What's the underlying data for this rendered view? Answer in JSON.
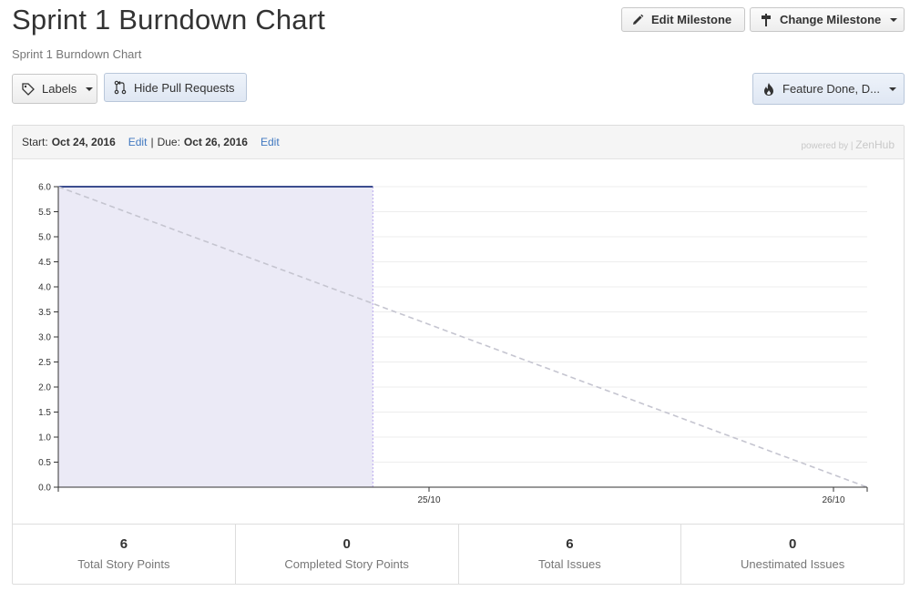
{
  "header": {
    "title": "Sprint 1 Burndown Chart",
    "subtitle": "Sprint 1 Burndown Chart"
  },
  "toolbar": {
    "edit_milestone_label": "Edit Milestone",
    "change_milestone_label": "Change Milestone",
    "labels_label": "Labels",
    "hide_pull_requests_label": "Hide Pull Requests",
    "filter_label": "Feature Done, D..."
  },
  "panel": {
    "start_prefix": "Start:",
    "start_date": "Oct 24, 2016",
    "edit_start_label": "Edit",
    "separator": "|",
    "due_prefix": "Due:",
    "due_date": "Oct 26, 2016",
    "edit_due_label": "Edit",
    "powered_by": "powered by |",
    "powered_brand": "ZenHub"
  },
  "chart_data": {
    "type": "area",
    "x_domain": [
      "2016-10-24T00:00",
      "2016-10-26T00:00"
    ],
    "ylim": [
      0,
      6
    ],
    "yticks": [
      "0.0",
      "0.5",
      "1.0",
      "1.5",
      "2.0",
      "2.5",
      "3.0",
      "3.5",
      "4.0",
      "4.5",
      "5.0",
      "5.5",
      "6.0"
    ],
    "xticks": [
      {
        "x": "2016-10-24T22:00",
        "label": "25/10"
      },
      {
        "x": "2016-10-25T22:00",
        "label": "26/10"
      }
    ],
    "series": [
      {
        "style": "solid-area",
        "points": [
          {
            "x": "2016-10-24T00:00",
            "y": 6
          },
          {
            "x": "2016-10-24T18:40",
            "y": 6
          }
        ]
      },
      {
        "style": "dashed-ideal",
        "points": [
          {
            "x": "2016-10-24T00:00",
            "y": 6
          },
          {
            "x": "2016-10-26T00:00",
            "y": 0
          }
        ]
      }
    ],
    "grid": true,
    "colors": {
      "actual": "#3c4d8f",
      "actual_fill": "#ebeaf6",
      "actual_edge": "#b9a7ee",
      "ideal": "#c5c5d0"
    }
  },
  "stats": [
    {
      "value": "6",
      "label": "Total Story Points"
    },
    {
      "value": "0",
      "label": "Completed Story Points"
    },
    {
      "value": "6",
      "label": "Total Issues"
    },
    {
      "value": "0",
      "label": "Unestimated Issues"
    }
  ]
}
